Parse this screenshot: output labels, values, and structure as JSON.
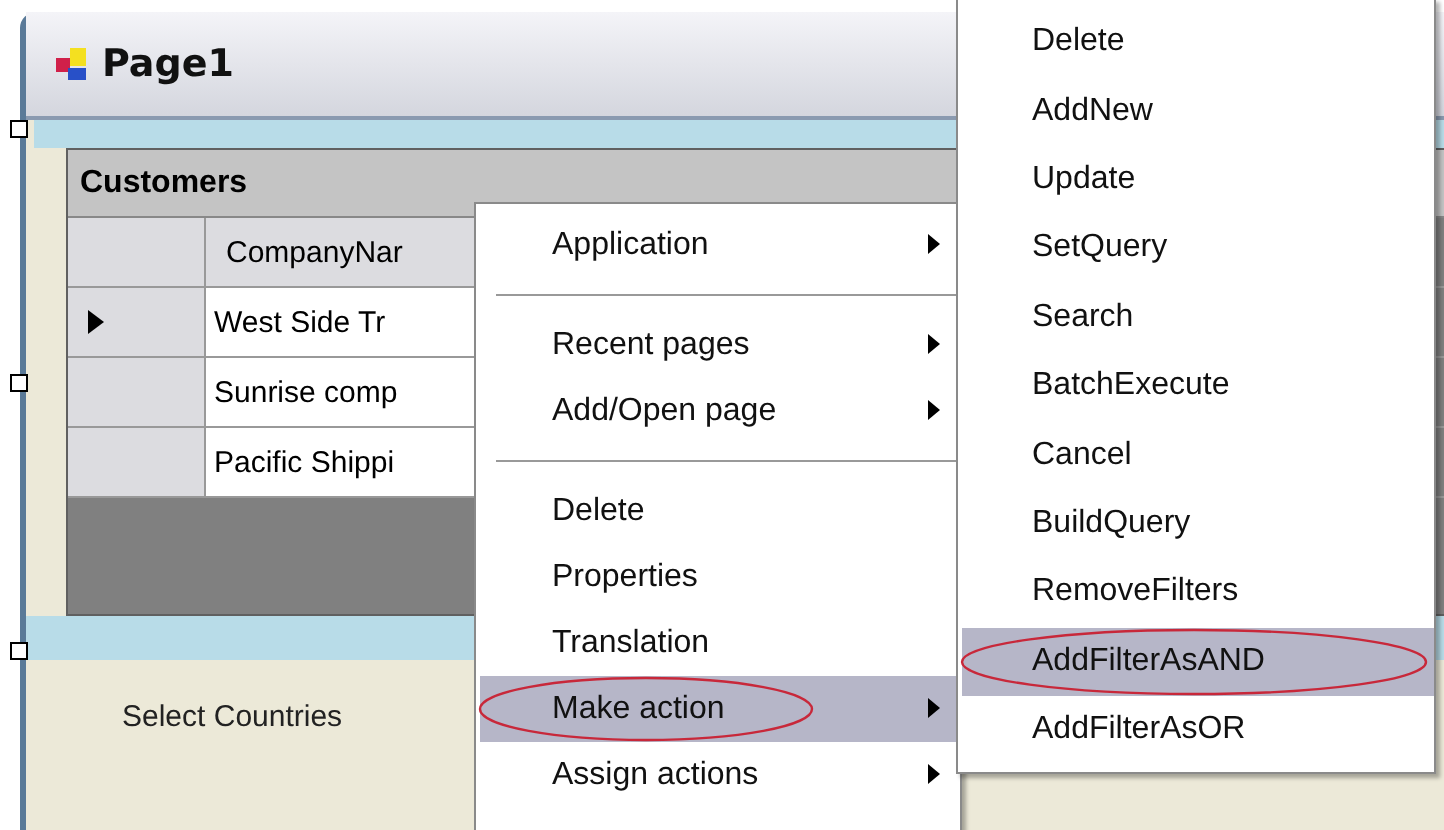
{
  "window": {
    "title": "Page1"
  },
  "grid": {
    "title": "Customers",
    "columns": [
      "CompanyNar"
    ],
    "rows": [
      {
        "current": true,
        "cells": [
          "West Side Tr"
        ]
      },
      {
        "current": false,
        "cells": [
          "Sunrise comp"
        ]
      },
      {
        "current": false,
        "cells": [
          "Pacific Shippi"
        ]
      }
    ]
  },
  "filter_label": "Select Countries",
  "context_menu": [
    {
      "kind": "item",
      "label": "Application",
      "submenu": true,
      "selected": false,
      "circled": false
    },
    {
      "kind": "separator"
    },
    {
      "kind": "item",
      "label": "Recent pages",
      "submenu": true,
      "selected": false,
      "circled": false
    },
    {
      "kind": "item",
      "label": "Add/Open page",
      "submenu": true,
      "selected": false,
      "circled": false
    },
    {
      "kind": "separator"
    },
    {
      "kind": "item",
      "label": "Delete",
      "submenu": false,
      "selected": false,
      "circled": false
    },
    {
      "kind": "item",
      "label": "Properties",
      "submenu": false,
      "selected": false,
      "circled": false
    },
    {
      "kind": "item",
      "label": "Translation",
      "submenu": false,
      "selected": false,
      "circled": false
    },
    {
      "kind": "item",
      "label": "Make action",
      "submenu": true,
      "selected": true,
      "circled": true
    },
    {
      "kind": "item",
      "label": "Assign actions",
      "submenu": true,
      "selected": false,
      "circled": false
    }
  ],
  "submenu": [
    {
      "label": "Delete",
      "selected": false,
      "circled": false
    },
    {
      "label": "AddNew",
      "selected": false,
      "circled": false
    },
    {
      "label": "Update",
      "selected": false,
      "circled": false
    },
    {
      "label": "SetQuery",
      "selected": false,
      "circled": false
    },
    {
      "label": "Search",
      "selected": false,
      "circled": false
    },
    {
      "label": "BatchExecute",
      "selected": false,
      "circled": false
    },
    {
      "label": "Cancel",
      "selected": false,
      "circled": false
    },
    {
      "label": "BuildQuery",
      "selected": false,
      "circled": false
    },
    {
      "label": "RemoveFilters",
      "selected": false,
      "circled": false
    },
    {
      "label": "AddFilterAsAND",
      "selected": true,
      "circled": true
    },
    {
      "label": "AddFilterAsOR",
      "selected": false,
      "circled": false
    }
  ]
}
